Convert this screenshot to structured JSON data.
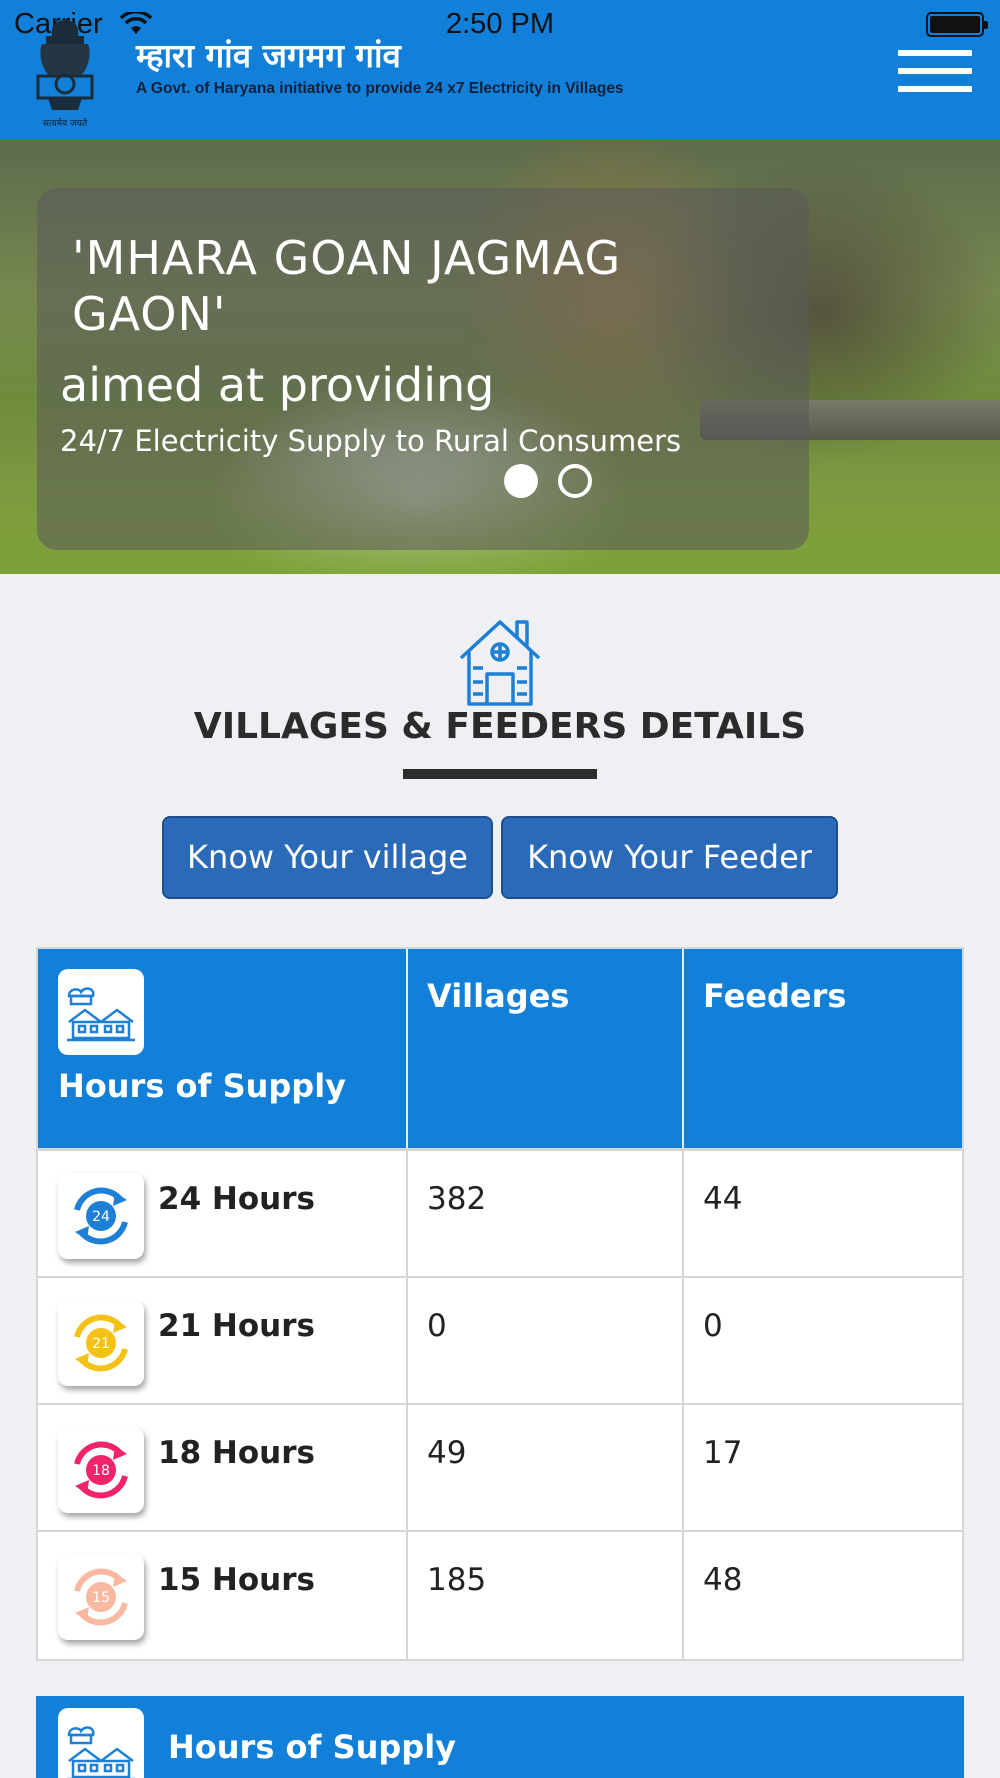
{
  "status": {
    "carrier": "Carrier",
    "time": "2:50 PM"
  },
  "header": {
    "title": "म्हारा गांव जगमग गांव",
    "subtitle": "A Govt. of Haryana initiative to provide 24 x7 Electricity in Villages",
    "emblem_caption": "सत्यमेव जयते"
  },
  "banner": {
    "headline": "'MHARA GOAN JAGMAG GAON'",
    "line2": "aimed at providing",
    "line3": "24/7 Electricity Supply to Rural Consumers",
    "slides": 2,
    "active_slide": 1
  },
  "section": {
    "title": "VILLAGES & FEEDERS DETAILS"
  },
  "buttons": {
    "village": "Know Your village",
    "feeder": "Know Your Feeder"
  },
  "table": {
    "headers": {
      "hours": "Hours of Supply",
      "villages": "Villages",
      "feeders": "Feeders"
    },
    "rows": [
      {
        "badge": "24",
        "label": "24 Hours",
        "villages": "382",
        "feeders": "44",
        "color": "#1e7fd6"
      },
      {
        "badge": "21",
        "label": "21 Hours",
        "villages": "0",
        "feeders": "0",
        "color": "#f6c117"
      },
      {
        "badge": "18",
        "label": "18 Hours",
        "villages": "49",
        "feeders": "17",
        "color": "#f0236b"
      },
      {
        "badge": "15",
        "label": "15 Hours",
        "villages": "185",
        "feeders": "48",
        "color": "#f8b9a0"
      }
    ]
  },
  "bottom": {
    "label": "Hours of Supply"
  },
  "colors": {
    "primary": "#127fd9",
    "button": "#2a6ab6",
    "background": "#eff0f4"
  }
}
